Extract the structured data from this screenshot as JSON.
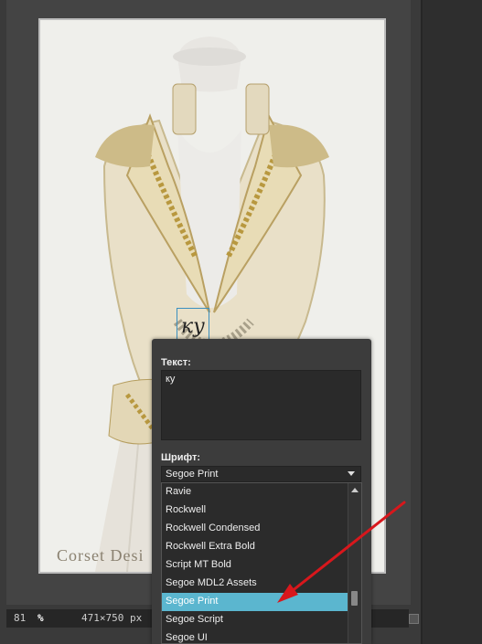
{
  "canvas": {
    "watermark": "Corset Desi",
    "text_layer_content": "ку"
  },
  "status_bar": {
    "zoom": "81",
    "zoom_unit": "%",
    "image_size": "471×750 px"
  },
  "text_panel": {
    "text_label": "Текст:",
    "text_value": "ку",
    "font_label": "Шрифт:",
    "font_selected": "Segoe Print",
    "font_options": [
      "Ravie",
      "Rockwell",
      "Rockwell Condensed",
      "Rockwell Extra Bold",
      "Script MT Bold",
      "Segoe MDL2 Assets",
      "Segoe Print",
      "Segoe Script",
      "Segoe UI"
    ],
    "highlighted_index": 6
  },
  "colors": {
    "workspace": "#3a3a3a",
    "highlight": "#5bb6cf",
    "annotation_arrow": "#d8171c"
  },
  "icons": {
    "dropdown": "chevron-down-icon",
    "scroll_up": "scroll-up-icon",
    "resize": "resize-grip-icon"
  }
}
